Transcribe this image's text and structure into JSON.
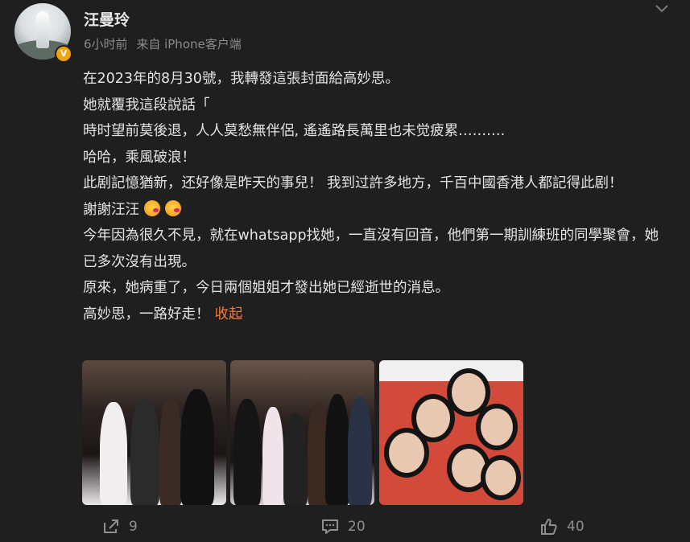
{
  "post": {
    "author": "汪曼玲",
    "time": "6小时前",
    "source": "来自 iPhone客户端",
    "verified_mark": "V",
    "lines": [
      "在2023年的8月30號，我轉發這張封面給高妙思。",
      "她就覆我這段說話「",
      "時时望前莫後退，人人莫愁無伴侶, 遙遙路長萬里也未觉疲累……….",
      "哈哈，乘風破浪！",
      "此剧記憶猶新，还好像是昨天的事兒！ 我到过許多地方，千百中國香港人都記得此剧！",
      "謝謝汪汪",
      "今年因為很久不見，就在whatsapp找她，一直沒有回音，他們第一期訓練班的同學聚會，她已多次沒有出現。",
      "原來，她病重了，今日兩個姐姐才發出她已經逝世的消息。",
      "高妙思，一路好走！"
    ],
    "collapse_label": "收起",
    "emojis": [
      "kiss-emoji",
      "kiss-emoji"
    ]
  },
  "photos": [
    {
      "name": "photo-group-1"
    },
    {
      "name": "photo-group-2"
    },
    {
      "name": "photo-magazine-cover"
    }
  ],
  "actions": {
    "share_count": "9",
    "comment_count": "20",
    "like_count": "40"
  },
  "icons": {
    "share": "share-icon",
    "comment": "comment-icon",
    "like": "thumbs-up-icon",
    "menu": "chevron-down-icon"
  },
  "colors": {
    "background": "#1f1f1f",
    "text": "#e4e4e4",
    "muted": "#8b8b8b",
    "link": "#f07b3f",
    "verified": "#f2a20c"
  }
}
